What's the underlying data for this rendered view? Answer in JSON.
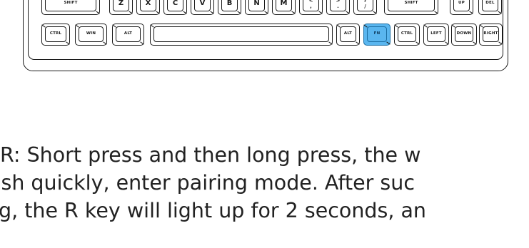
{
  "keyboard": {
    "row_shift": {
      "shift_left": "SHIFT",
      "z": "Z",
      "x": "X",
      "c": "C",
      "v": "V",
      "b": "B",
      "n": "N",
      "m": "M",
      "comma_top": "<",
      "comma_bottom": ",",
      "period_top": ">",
      "period_bottom": ".",
      "slash_top": "?",
      "slash_bottom": "/",
      "shift_right": "SHIFT",
      "up": "UP",
      "del": "DEL"
    },
    "row_bottom": {
      "ctrl_left": "CTRL",
      "win": "WIN",
      "alt_left": "ALT",
      "space": "",
      "alt_right": "ALT",
      "fn": "FN",
      "ctrl_right": "CTRL",
      "left": "LEFT",
      "down": "DOWN",
      "right": "RIGHT"
    },
    "highlight_color": "#5ab6ef"
  },
  "description": {
    "line1": "R: Short press and then long press, the w",
    "line2": "ash quickly, enter pairing mode. After suc",
    "line3": "g, the R key will light up for 2 seconds, an"
  }
}
